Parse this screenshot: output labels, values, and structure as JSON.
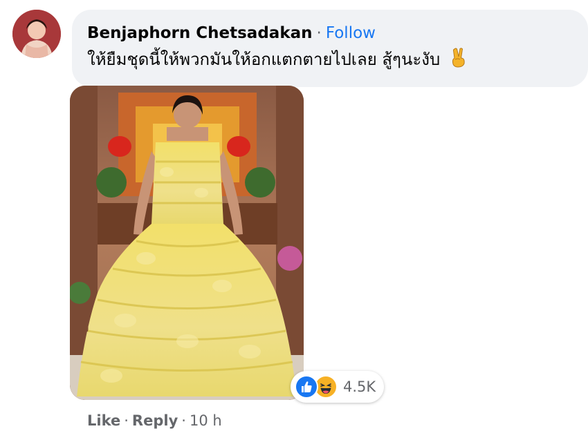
{
  "comment": {
    "author": "Benjaphorn Chetsadakan",
    "separator": "·",
    "follow_label": "Follow",
    "text": "ให้ยืมชุดนี้ให้พวกมันให้อกแตกตายไปเลย สู้ๆนะงับ",
    "emoji": "victory-hand",
    "reactions": {
      "types": [
        "like",
        "haha"
      ],
      "count": "4.5K"
    },
    "actions": {
      "like_label": "Like",
      "reply_label": "Reply",
      "separator": "·",
      "timestamp": "10 h"
    }
  },
  "colors": {
    "bubble_bg": "#f0f2f5",
    "link_blue": "#1877f2",
    "secondary_text": "#65676b",
    "like_blue": "#1877f2",
    "haha_yellow": "#f7b125"
  }
}
